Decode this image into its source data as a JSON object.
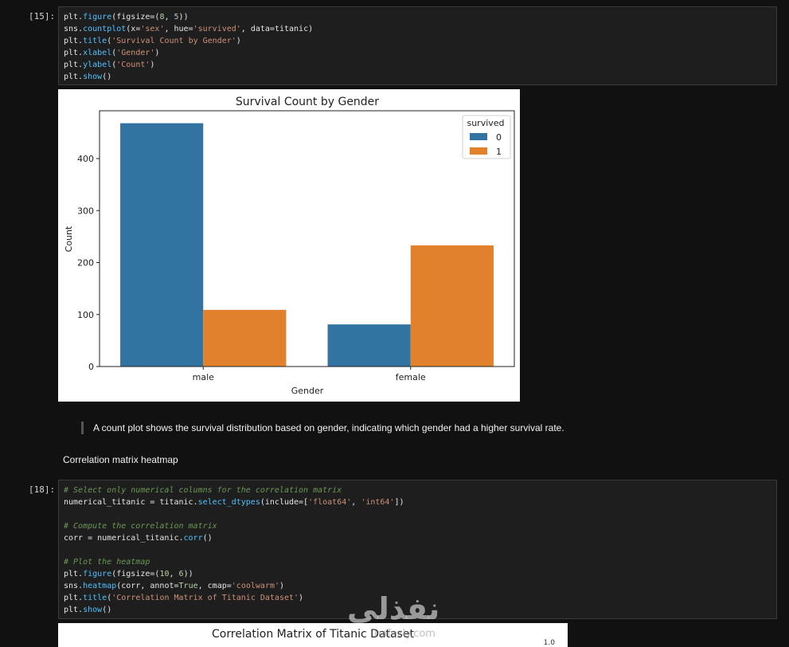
{
  "cells": [
    {
      "prompt": "[15]:",
      "lines": [
        [
          [
            "plt.",
            "t"
          ],
          [
            "figure",
            "k"
          ],
          [
            "(figsize=(",
            "t"
          ],
          [
            "8",
            "n"
          ],
          [
            ", ",
            "t"
          ],
          [
            "5",
            "n"
          ],
          [
            "))",
            "t"
          ]
        ],
        [
          [
            "sns.",
            "t"
          ],
          [
            "countplot",
            "k"
          ],
          [
            "(x=",
            "t"
          ],
          [
            "'sex'",
            "s"
          ],
          [
            ", hue=",
            "t"
          ],
          [
            "'survived'",
            "s"
          ],
          [
            ", data=titanic)",
            "t"
          ]
        ],
        [
          [
            "plt.",
            "t"
          ],
          [
            "title",
            "k"
          ],
          [
            "(",
            "t"
          ],
          [
            "'Survival Count by Gender'",
            "s"
          ],
          [
            ")",
            "t"
          ]
        ],
        [
          [
            "plt.",
            "t"
          ],
          [
            "xlabel",
            "k"
          ],
          [
            "(",
            "t"
          ],
          [
            "'Gender'",
            "s"
          ],
          [
            ")",
            "t"
          ]
        ],
        [
          [
            "plt.",
            "t"
          ],
          [
            "ylabel",
            "k"
          ],
          [
            "(",
            "t"
          ],
          [
            "'Count'",
            "s"
          ],
          [
            ")",
            "t"
          ]
        ],
        [
          [
            "plt.",
            "t"
          ],
          [
            "show",
            "k"
          ],
          [
            "()",
            "t"
          ]
        ]
      ]
    },
    {
      "prompt": "[18]:",
      "lines": [
        [
          [
            "# Select only numerical columns for the correlation matrix",
            "c"
          ]
        ],
        [
          [
            "numerical_titanic = titanic.",
            "t"
          ],
          [
            "select_dtypes",
            "k"
          ],
          [
            "(include=[",
            "t"
          ],
          [
            "'float64'",
            "s"
          ],
          [
            ", ",
            "t"
          ],
          [
            "'int64'",
            "s"
          ],
          [
            "])",
            "t"
          ]
        ],
        [],
        [
          [
            "# Compute the correlation matrix",
            "c"
          ]
        ],
        [
          [
            "corr = numerical_titanic.",
            "t"
          ],
          [
            "corr",
            "k"
          ],
          [
            "()",
            "t"
          ]
        ],
        [],
        [
          [
            "# Plot the heatmap",
            "c"
          ]
        ],
        [
          [
            "plt.",
            "t"
          ],
          [
            "figure",
            "k"
          ],
          [
            "(figsize=(",
            "t"
          ],
          [
            "10",
            "n"
          ],
          [
            ", ",
            "t"
          ],
          [
            "6",
            "n"
          ],
          [
            "))",
            "t"
          ]
        ],
        [
          [
            "sns.",
            "t"
          ],
          [
            "heatmap",
            "k"
          ],
          [
            "(corr, annot=",
            "t"
          ],
          [
            "True",
            "n"
          ],
          [
            ", cmap=",
            "t"
          ],
          [
            "'coolwarm'",
            "s"
          ],
          [
            ")",
            "t"
          ]
        ],
        [
          [
            "plt.",
            "t"
          ],
          [
            "title",
            "k"
          ],
          [
            "(",
            "t"
          ],
          [
            "'Correlation Matrix of Titanic Dataset'",
            "s"
          ],
          [
            ")",
            "t"
          ]
        ],
        [
          [
            "plt.",
            "t"
          ],
          [
            "show",
            "k"
          ],
          [
            "()",
            "t"
          ]
        ]
      ]
    }
  ],
  "chart_data": {
    "type": "bar",
    "title": "Survival Count by Gender",
    "xlabel": "Gender",
    "ylabel": "Count",
    "categories": [
      "male",
      "female"
    ],
    "series": [
      {
        "name": "0",
        "values": [
          468,
          81
        ],
        "color": "#3274a1"
      },
      {
        "name": "1",
        "values": [
          109,
          233
        ],
        "color": "#e1812c"
      }
    ],
    "ylim": [
      0,
      492
    ],
    "yticks": [
      0,
      100,
      200,
      300,
      400
    ],
    "legend_title": "survived",
    "legend_position": "top-right",
    "grid": false
  },
  "markdown": {
    "quote": "A count plot shows the survival distribution based on gender, indicating which gender had a higher survival rate.",
    "heading": "Correlation matrix heatmap"
  },
  "heatmap_preview": {
    "title": "Correlation Matrix of Titanic Dataset",
    "colorbar_top_tick": "1.0"
  },
  "watermark": {
    "text": "نفذلي",
    "sub": "nafezly.com"
  },
  "colors": {
    "background": "#111111",
    "code_background": "#1e1e1e",
    "keyword": "#4fc1ff",
    "string": "#ce9178",
    "number": "#b5cea8",
    "comment": "#6a9955"
  }
}
